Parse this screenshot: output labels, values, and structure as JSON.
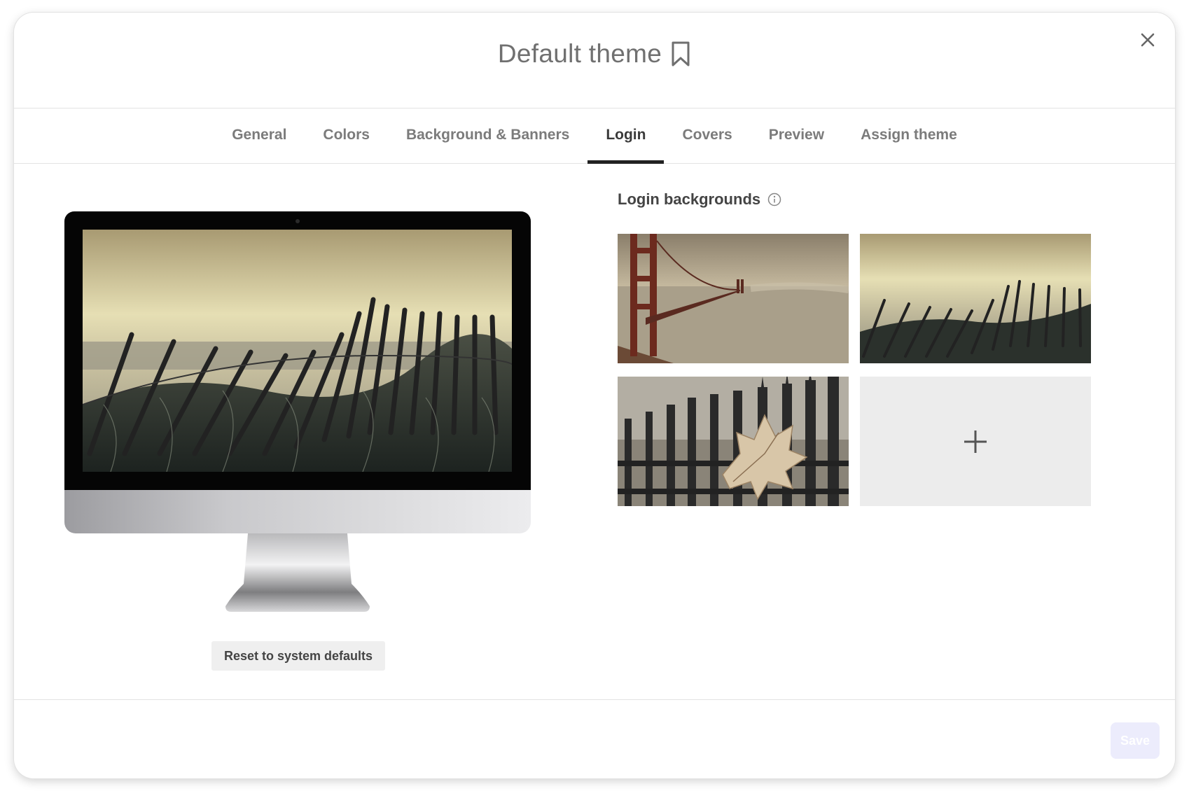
{
  "header": {
    "title": "Default theme",
    "bookmark_icon": "bookmark-icon",
    "close_icon": "close-icon"
  },
  "tabs": [
    {
      "label": "General",
      "active": false
    },
    {
      "label": "Colors",
      "active": false
    },
    {
      "label": "Background & Banners",
      "active": false
    },
    {
      "label": "Login",
      "active": true
    },
    {
      "label": "Covers",
      "active": false
    },
    {
      "label": "Preview",
      "active": false
    },
    {
      "label": "Assign theme",
      "active": false
    }
  ],
  "preview": {
    "reset_label": "Reset to system defaults"
  },
  "login_backgrounds": {
    "title": "Login backgrounds",
    "info_icon": "info-icon",
    "add_icon": "plus-icon"
  },
  "footer": {
    "save_label": "Save",
    "save_disabled": true
  },
  "colors": {
    "active_tab_underline": "#222222",
    "save_button_bg": "#ececfc",
    "add_tile_bg": "#ececec"
  }
}
